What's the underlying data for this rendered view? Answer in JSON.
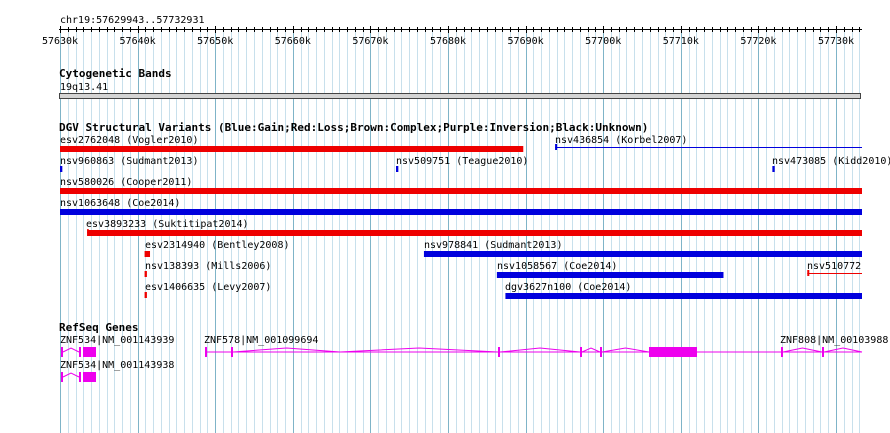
{
  "ruler": {
    "region": "chr19:57629943..57732931",
    "ticks": [
      "57630k",
      "57640k",
      "57650k",
      "57660k",
      "57670k",
      "57680k",
      "57690k",
      "57700k",
      "57710k",
      "57720k",
      "57730k"
    ]
  },
  "tracks": {
    "cytoband": {
      "title": "Cytogenetic Bands",
      "band": "19q13.41"
    },
    "dgv": {
      "title": "DGV Structural Variants (Blue:Gain;Red:Loss;Brown:Complex;Purple:Inversion;Black:Unknown)",
      "features": [
        {
          "id": "dgv0",
          "label": "esv2762048 (Vogler2010)",
          "color": "red",
          "start": 57630000,
          "end": 57689700,
          "row": 0
        },
        {
          "id": "dgv1",
          "label": "nsv436854 (Korbel2007)",
          "color": "blue",
          "start": 57693800,
          "end": 57733500,
          "row": 0,
          "thin": true
        },
        {
          "id": "dgv2",
          "label": "nsv960863 (Sudmant2013)",
          "color": "blue",
          "start": 57630000,
          "end": 57630300,
          "row": 1
        },
        {
          "id": "dgv3",
          "label": "nsv509751 (Teague2010)",
          "color": "blue",
          "start": 57673300,
          "end": 57673600,
          "row": 1
        },
        {
          "id": "dgv4",
          "label": "nsv473085 (Kidd2010)",
          "color": "blue",
          "start": 57721800,
          "end": 57722100,
          "row": 1
        },
        {
          "id": "dgv5",
          "label": "nsv580026 (Cooper2011)",
          "color": "red",
          "start": 57630000,
          "end": 57733500,
          "row": 2
        },
        {
          "id": "dgv6",
          "label": "nsv1063648 (Coe2014)",
          "color": "blue",
          "start": 57630000,
          "end": 57733500,
          "row": 3
        },
        {
          "id": "dgv7",
          "label": "esv3893233 (Suktitipat2014)",
          "color": "red",
          "start": 57633500,
          "end": 57733500,
          "row": 4,
          "whisker": 57637300
        },
        {
          "id": "dgv8",
          "label": "esv2314940 (Bentley2008)",
          "color": "red",
          "start": 57640900,
          "end": 57641600,
          "row": 5
        },
        {
          "id": "dgv9",
          "label": "nsv978841 (Sudmant2013)",
          "color": "blue",
          "start": 57676900,
          "end": 57733500,
          "row": 5
        },
        {
          "id": "dgv10",
          "label": "nsv138393 (Mills2006)",
          "color": "red",
          "start": 57640900,
          "end": 57641200,
          "row": 6
        },
        {
          "id": "dgv11",
          "label": "nsv1058567 (Coe2014)",
          "color": "blue",
          "start": 57686300,
          "end": 57715500,
          "row": 6
        },
        {
          "id": "dgv12",
          "label": "nsv510772",
          "color": "red",
          "start": 57726300,
          "end": 57733500,
          "row": 6,
          "thin": true
        },
        {
          "id": "dgv13",
          "label": "esv1406635 (Levy2007)",
          "color": "red",
          "start": 57640900,
          "end": 57641200,
          "row": 7
        },
        {
          "id": "dgv14",
          "label": "dgv3627n100 (Coe2014)",
          "color": "blue",
          "start": 57687400,
          "end": 57733500,
          "row": 7
        }
      ]
    },
    "refseq": {
      "title": "RefSeq Genes",
      "genes": [
        {
          "id": "g0",
          "label": "ZNF534|NM_001143939",
          "row": 0
        },
        {
          "id": "g1",
          "label": "ZNF578|NM_001099694",
          "row": 0
        },
        {
          "id": "g2",
          "label": "ZNF808|NM_00103988",
          "row": 0
        },
        {
          "id": "g3",
          "label": "ZNF534|NM_001143938",
          "row": 1
        }
      ]
    }
  },
  "colors": {
    "grid_major": "#7fb4c8",
    "grid_minor": "#c8e0ec",
    "gain": "#0000dd",
    "loss": "#ee0000",
    "gene": "#ee00ee",
    "band": "#d4d4d4"
  }
}
